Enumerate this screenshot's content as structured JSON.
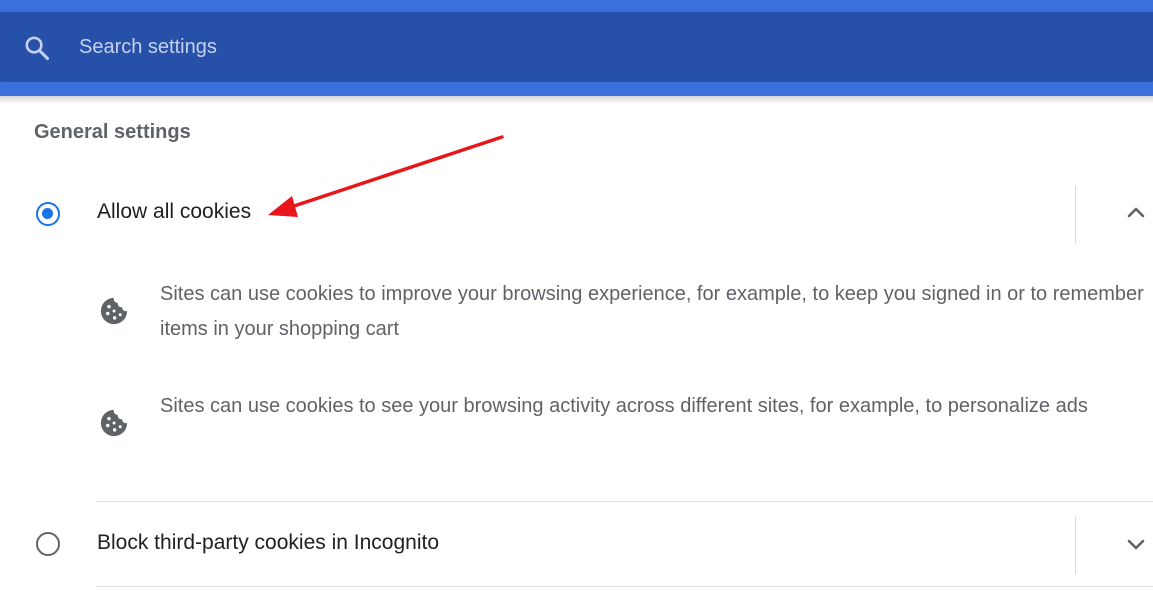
{
  "search": {
    "placeholder": "Search settings",
    "icon": "search-icon"
  },
  "section": {
    "title": "General settings"
  },
  "options": [
    {
      "label": "Allow all cookies",
      "selected": true,
      "expanded": true,
      "descriptions": [
        "Sites can use cookies to improve your browsing experience, for example, to keep you signed in or to remember items in your shopping cart",
        "Sites can use cookies to see your browsing activity across different sites, for example, to personalize ads"
      ]
    },
    {
      "label": "Block third-party cookies in Incognito",
      "selected": false,
      "expanded": false
    }
  ],
  "colors": {
    "header": "#3b6fdb",
    "search_bar": "#2751a8",
    "accent": "#1a73e8",
    "annotation_arrow": "#e8161b"
  }
}
